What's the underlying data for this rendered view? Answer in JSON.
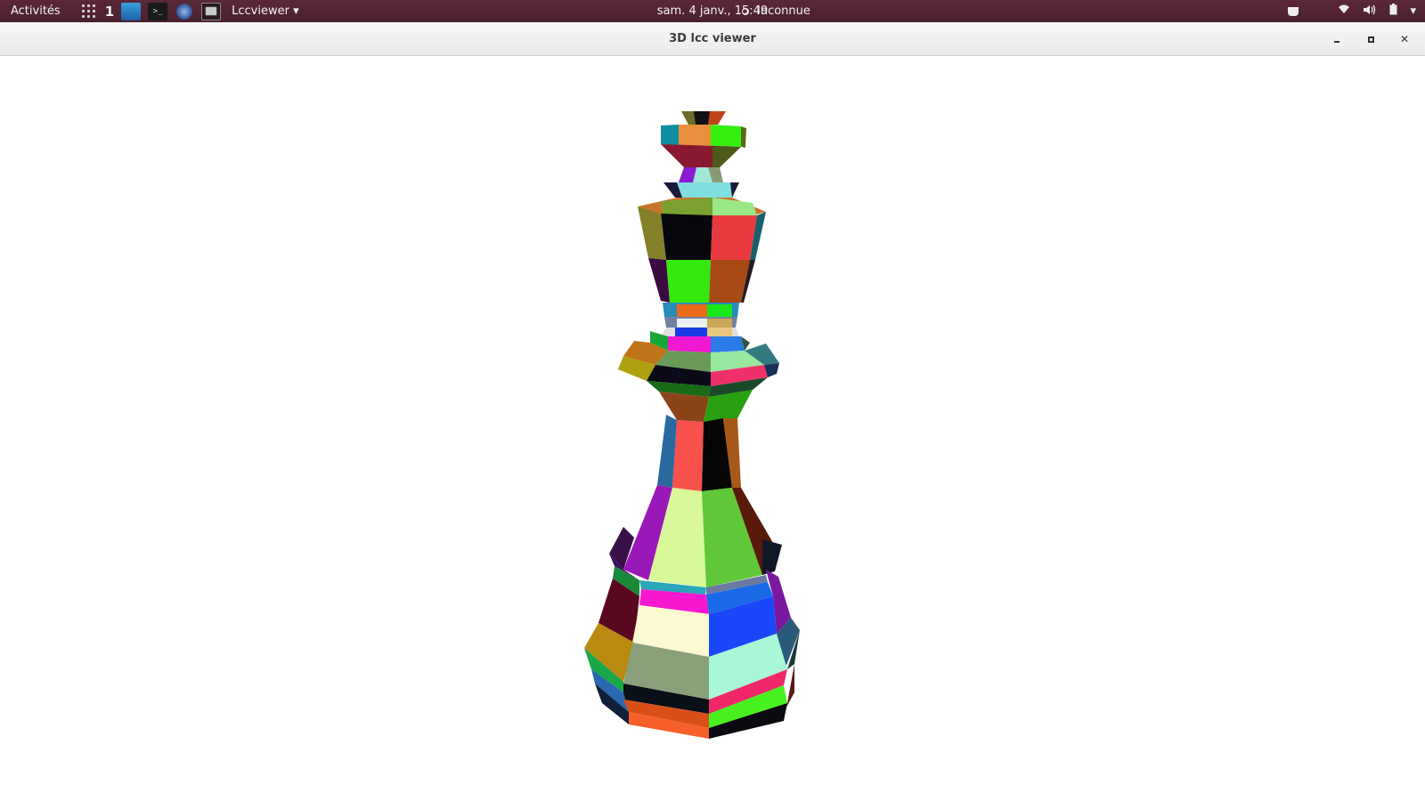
{
  "topbar": {
    "activities": "Activités",
    "workspace_number": "1",
    "app_menu": "Lccviewer ▾",
    "clock": "sam.   4 janv., 15:49",
    "weather_label": "Inconnue",
    "tray": {
      "wifi": "wifi-icon",
      "volume": "volume-icon",
      "battery": "battery-icon",
      "menu_arrow": "▾"
    }
  },
  "window": {
    "title": "3D lcc viewer",
    "minimize": "minimize-icon",
    "maximize": "maximize-icon",
    "close": "close-icon"
  },
  "viewer": {
    "background": "#ffffff",
    "model": "chess-king-lcc-mesh"
  }
}
